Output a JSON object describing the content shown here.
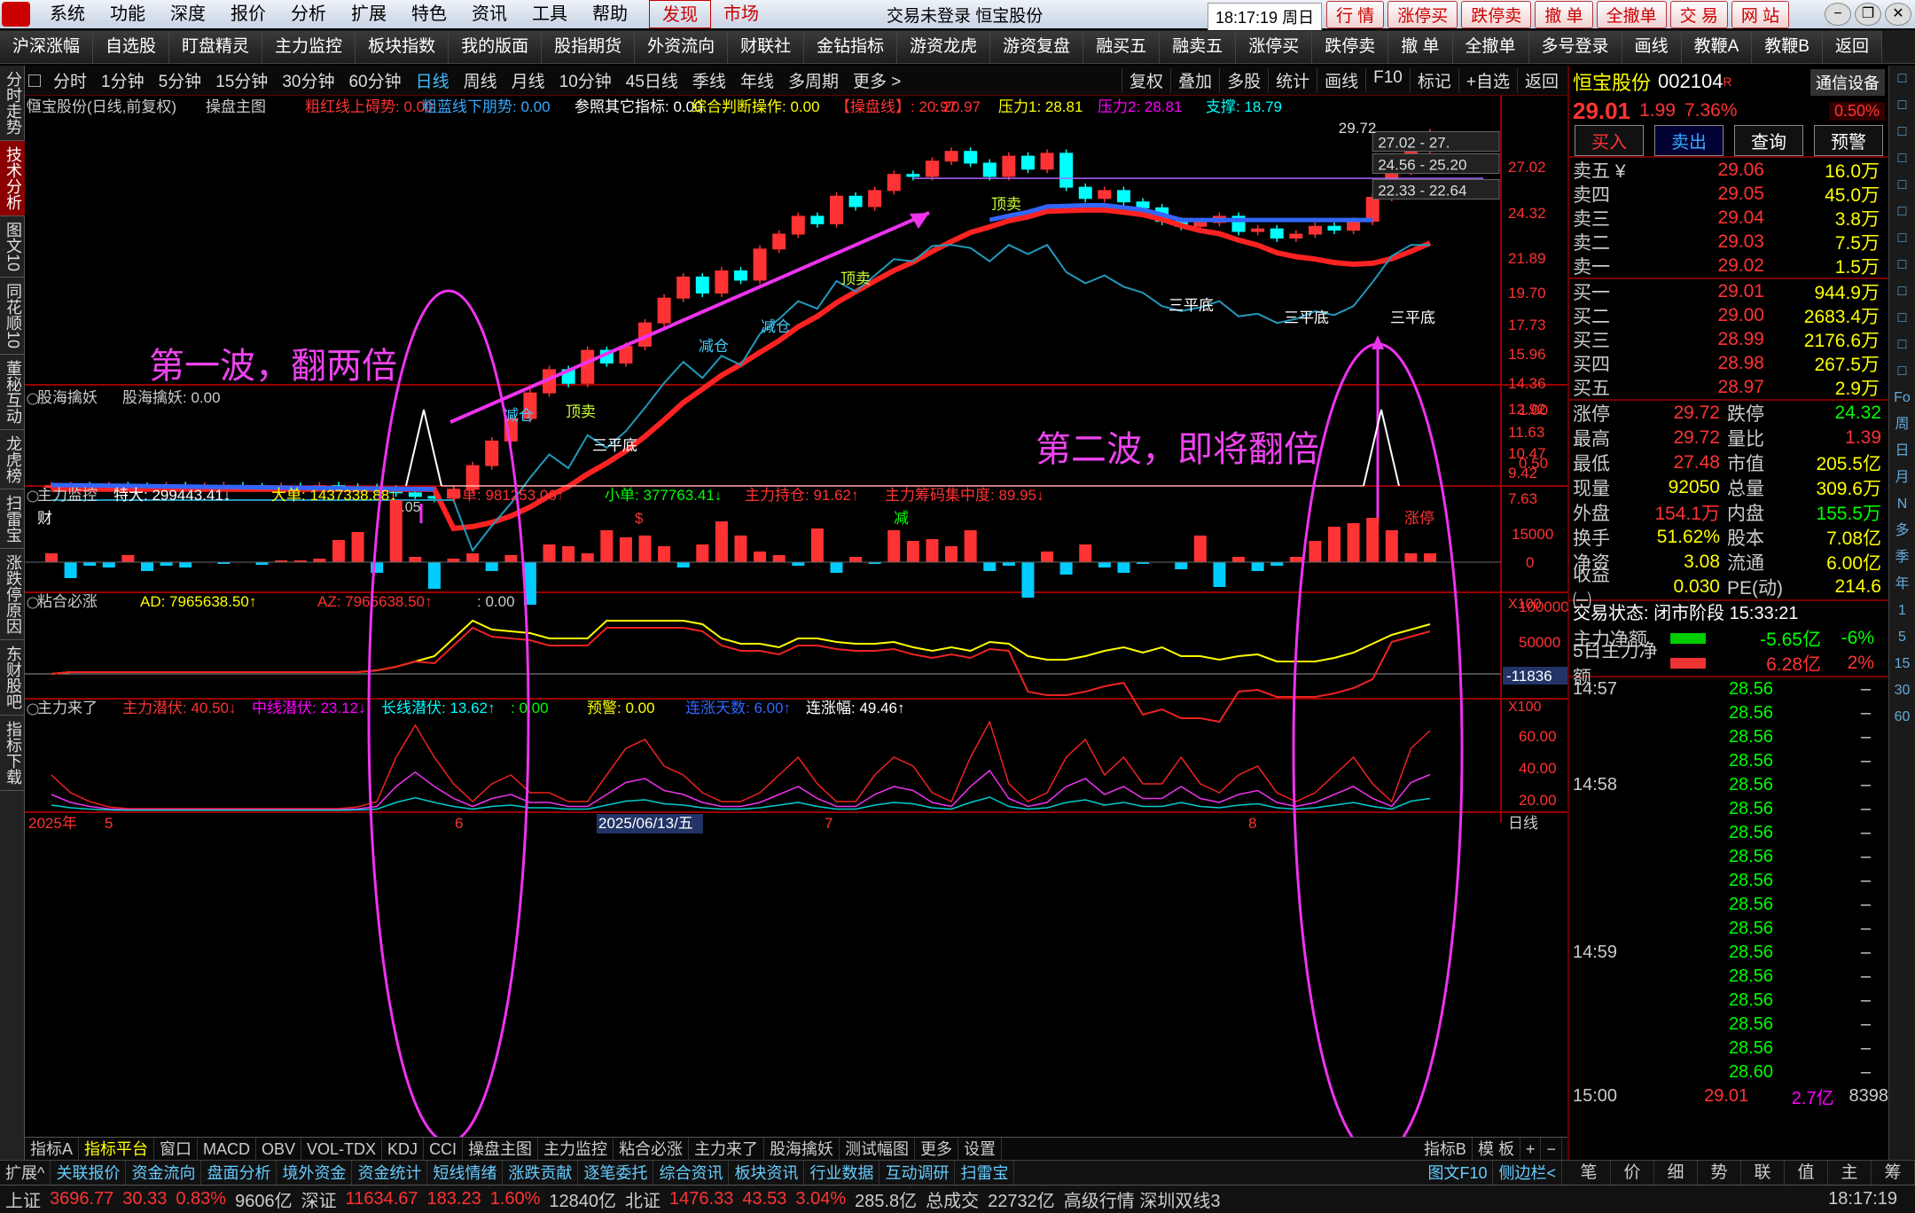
{
  "menu": [
    "系统",
    "功能",
    "深度",
    "报价",
    "分析",
    "扩展",
    "特色",
    "资讯",
    "工具",
    "帮助"
  ],
  "menu_hl": [
    "发现",
    "市场"
  ],
  "title_center": "交易未登录   恒宝股份",
  "clock": "18:17:19 周日",
  "title_btns": [
    "行 情",
    "涨停买",
    "跌停卖",
    "撤 单",
    "全撤单",
    "交 易",
    "网 站"
  ],
  "toolbar": [
    "沪深涨幅",
    "自选股",
    "盯盘精灵",
    "主力监控",
    "板块指数",
    "我的版面",
    "股指期货",
    "外资流向",
    "财联社",
    "金钻指标",
    "游资龙虎",
    "游资复盘",
    "融买五",
    "融卖五",
    "涨停买",
    "跌停卖",
    "撤 单",
    "全撤单",
    "多号登录",
    "画线",
    "教鞭A",
    "教鞭B",
    "返回"
  ],
  "leftside": [
    "分时走势",
    "技术分析",
    "图文10",
    "同花顺10",
    "董秘互动",
    "龙虎榜",
    "扫雷宝",
    "涨跌停原因",
    "东财股吧",
    "指标下载"
  ],
  "periods": [
    "分时",
    "1分钟",
    "5分钟",
    "15分钟",
    "30分钟",
    "60分钟",
    "日线",
    "周线",
    "月线",
    "10分钟",
    "45日线",
    "季线",
    "年线",
    "多周期",
    "更多 >"
  ],
  "period_right": [
    "复权",
    "叠加",
    "多股",
    "统计",
    "画线",
    "F10",
    "标记",
    "+自选",
    "返回"
  ],
  "chart_header": {
    "name": "恒宝股份(日线,前复权)",
    "main": "操盘主图",
    "a": "粗红线上碍势: 0.00",
    "b": "粗蓝线下朋势: 0.00",
    "c": "参照其它指标: 0.00",
    "d": "综合判断操作: 0.00",
    "e": "【操盘线】: 20.97",
    "f": ": 20.97",
    "g": "压力1: 28.81",
    "h": "压力2: 28.81",
    "i": "支撑: 18.79"
  },
  "annotations": {
    "wave1": "第一波，翻两倍",
    "wave2": "第二波，即将翻倍"
  },
  "chart_labels": {
    "high": "29.72",
    "low": "7.05",
    "zones": [
      "27.02 - 27.",
      "24.56 - 25.20",
      "22.33 - 22.64"
    ],
    "tags": [
      "顶卖",
      "顶卖",
      "顶卖",
      "减仓",
      "减仓",
      "减仓",
      "三平底",
      "三平底",
      "三平底",
      "三平底"
    ],
    "bottom": [
      "财",
      "$",
      "减",
      "涨停"
    ]
  },
  "y_axis_main": [
    "29.72",
    "27.02",
    "24.32",
    "21.89",
    "19.70",
    "17.73",
    "15.96",
    "14.36",
    "12.92",
    "11.63",
    "10.47",
    "9.42",
    "7.63"
  ],
  "sub1": {
    "title": "股海擒妖",
    "val": "股海擒妖: 0.00",
    "axis": [
      "1.00",
      "0.50"
    ]
  },
  "sub2": {
    "title": "主力监控",
    "items": [
      "特大: 299443.41↓",
      "大单: 1437338.88↓",
      "中单: 981253.06↑",
      "小单: 377763.41↓",
      "主力持仓: 91.62↑",
      "主力筹码集中度: 89.95↓"
    ],
    "axis": [
      "15000",
      "0",
      "X100"
    ]
  },
  "sub3": {
    "title": "粘合必涨",
    "items": [
      "AD: 7965638.50↑",
      "AZ: 7965638.50↑",
      ": 0.00"
    ],
    "axis": [
      "100000",
      "50000",
      "-11836",
      "X100"
    ]
  },
  "sub4": {
    "title": "主力来了",
    "items": [
      "主力潜伏: 40.50↓",
      "中线潜伏: 23.12↓",
      "长线潜伏: 13.62↑",
      ": 0.00",
      "预警: 0.00",
      "连涨天数: 6.00↑",
      "连涨幅: 49.46↑"
    ],
    "axis": [
      "60.00",
      "40.00",
      "20.00"
    ]
  },
  "xaxis": {
    "year": "2025年",
    "m5": "5",
    "m6": "6",
    "date": "2025/06/13/五",
    "m7": "7",
    "m8": "8",
    "right": "日线"
  },
  "bottomtabs": [
    "指标A",
    "指标平台",
    "窗口",
    "MACD",
    "OBV",
    "VOL-TDX",
    "KDJ",
    "CCI",
    "操盘主图",
    "主力监控",
    "粘合必涨",
    "主力来了",
    "股海擒妖",
    "测试幅图",
    "更多",
    "设置"
  ],
  "bottomtabs_r": [
    "指标B",
    "模 板",
    "+",
    "−"
  ],
  "bottomtabs2": [
    "扩展^",
    "关联报价",
    "资金流向",
    "盘面分析",
    "境外资金",
    "资金统计",
    "短线情绪",
    "涨跌贡献",
    "逐笔委托",
    "综合资讯",
    "板块资讯",
    "行业数据",
    "互动调研",
    "扫雷宝"
  ],
  "bottomtabs2_r": [
    "图文F10",
    "侧边栏<"
  ],
  "quote": {
    "name": "恒宝股份",
    "code": "002104",
    "flag": "R",
    "price": "29.01",
    "chg": "1.99",
    "pct": "7.36%",
    "comm": "通信设备",
    "comm_pct": "0.50%"
  },
  "trade_btns": [
    "买入",
    "卖出",
    "查询",
    "预警"
  ],
  "asks": [
    [
      "卖五 ¥",
      "29.06",
      "16.0万"
    ],
    [
      "卖四",
      "29.05",
      "45.0万"
    ],
    [
      "卖三",
      "29.04",
      "3.8万"
    ],
    [
      "卖二",
      "29.03",
      "7.5万"
    ],
    [
      "卖一",
      "29.02",
      "1.5万"
    ]
  ],
  "bids": [
    [
      "买一",
      "29.01",
      "944.9万"
    ],
    [
      "买二",
      "29.00",
      "2683.4万"
    ],
    [
      "买三",
      "28.99",
      "2176.6万"
    ],
    [
      "买四",
      "28.98",
      "267.5万"
    ],
    [
      "买五",
      "28.97",
      "2.9万"
    ]
  ],
  "info": [
    [
      "涨停",
      "29.72",
      "跌停",
      "24.32"
    ],
    [
      "最高",
      "29.72",
      "量比",
      "1.39"
    ],
    [
      "最低",
      "27.48",
      "市值",
      "205.5亿"
    ],
    [
      "现量",
      "92050",
      "总量",
      "309.6万"
    ],
    [
      "外盘",
      "154.1万",
      "内盘",
      "155.5万"
    ],
    [
      "换手",
      "51.62%",
      "股本",
      "7.08亿"
    ],
    [
      "净资",
      "3.08",
      "流通",
      "6.00亿"
    ],
    [
      "收益㈠",
      "0.030",
      "PE(动)",
      "214.6"
    ]
  ],
  "status": "交易状态: 闭市阶段 15:33:21",
  "flow": [
    [
      "主力净额",
      "-5.65亿",
      "-6%"
    ],
    [
      "5日主力净额",
      "6.28亿",
      "2%"
    ]
  ],
  "ticks": [
    [
      "14:57",
      "28.56"
    ],
    [
      "",
      "28.56"
    ],
    [
      "",
      "28.56"
    ],
    [
      "",
      "28.56"
    ],
    [
      "14:58",
      "28.56"
    ],
    [
      "",
      "28.56"
    ],
    [
      "",
      "28.56"
    ],
    [
      "",
      "28.56"
    ],
    [
      "",
      "28.56"
    ],
    [
      "",
      "28.56"
    ],
    [
      "",
      "28.56"
    ],
    [
      "14:59",
      "28.56"
    ],
    [
      "",
      "28.56"
    ],
    [
      "",
      "28.56"
    ],
    [
      "",
      "28.56"
    ],
    [
      "",
      "28.56"
    ],
    [
      "",
      "28.60"
    ],
    [
      "15:00",
      "29.01",
      "2.7亿",
      "8398"
    ]
  ],
  "rtabs": [
    "笔",
    "价",
    "细",
    "势",
    "联",
    "值",
    "主",
    "筹"
  ],
  "farright": [
    "Fo",
    "周",
    "日",
    "月",
    "N",
    "多",
    "季",
    "年",
    "1",
    "5",
    "15",
    "30",
    "60"
  ],
  "statusbar": {
    "sh": "上证",
    "sh_v": "3696.77",
    "sh_c": "30.33",
    "sh_p": "0.83%",
    "sh_a": "9606亿",
    "sz": "深证",
    "sz_v": "11634.67",
    "sz_c": "183.23",
    "sz_p": "1.60%",
    "sz_a": "12840亿",
    "bz": "北证",
    "bz_v": "1476.33",
    "bz_c": "43.53",
    "bz_p": "3.04%",
    "bz_a": "285.8亿",
    "total": "总成交",
    "total_v": "22732亿",
    "adv": "高级行情 深圳双线3",
    "time": "18:17:19"
  }
}
